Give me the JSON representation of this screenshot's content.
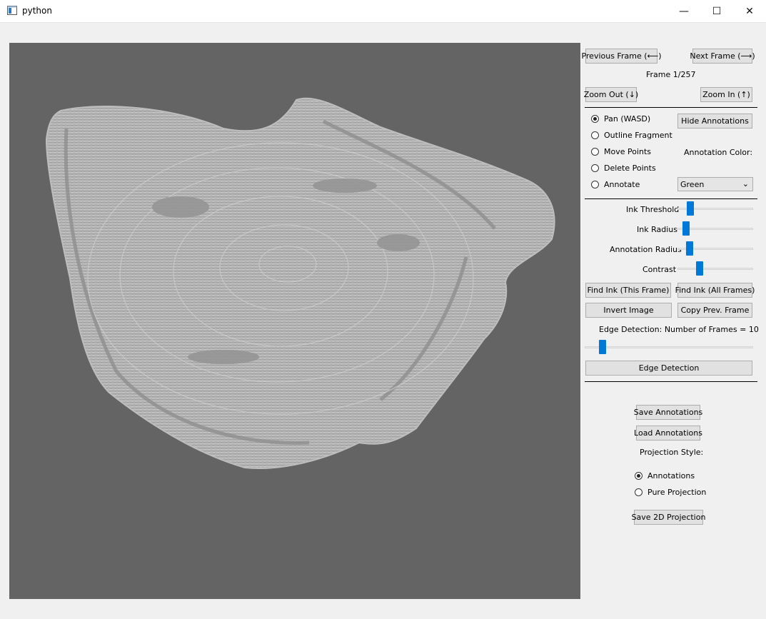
{
  "window": {
    "title": "python",
    "minimize": "—",
    "maximize": "☐",
    "close": "✕"
  },
  "nav": {
    "prev_frame": "Previous Frame (⟵)",
    "next_frame": "Next Frame (⟶)",
    "frame_label": "Frame 1/257",
    "zoom_out": "Zoom Out (↓)",
    "zoom_in": "Zoom In (↑)"
  },
  "modes": {
    "items": [
      {
        "label": "Pan (WASD)",
        "checked": true
      },
      {
        "label": "Outline Fragment",
        "checked": false
      },
      {
        "label": "Move Points",
        "checked": false
      },
      {
        "label": "Delete Points",
        "checked": false
      },
      {
        "label": "Annotate",
        "checked": false
      }
    ]
  },
  "annotation": {
    "hide_button": "Hide Annotations",
    "color_label": "Annotation Color:",
    "color_value": "Green"
  },
  "sliders": [
    {
      "label": "Ink Threshold",
      "value": 0.14
    },
    {
      "label": "Ink Radius",
      "value": 0.07
    },
    {
      "label": "Annotation Radius",
      "value": 0.12
    },
    {
      "label": "Contrast",
      "value": 0.27
    }
  ],
  "actions": {
    "find_ink_frame": "Find Ink (This Frame)",
    "find_ink_all": "Find Ink (All Frames)",
    "invert_image": "Invert Image",
    "copy_prev_frame": "Copy Prev. Frame"
  },
  "edge": {
    "label": "Edge Detection: Number of Frames = 10",
    "slider_value": 0.09,
    "button": "Edge Detection"
  },
  "files": {
    "save_annotations": "Save Annotations",
    "load_annotations": "Load Annotations",
    "projection_style_label": "Projection Style:",
    "projection_options": [
      {
        "label": "Annotations",
        "checked": true
      },
      {
        "label": "Pure Projection",
        "checked": false
      }
    ],
    "save_projection": "Save 2D Projection"
  },
  "colors": {
    "canvas_bg": "#646464",
    "scan_fill": "#a9a9a9",
    "slider_accent": "#0078d7"
  }
}
